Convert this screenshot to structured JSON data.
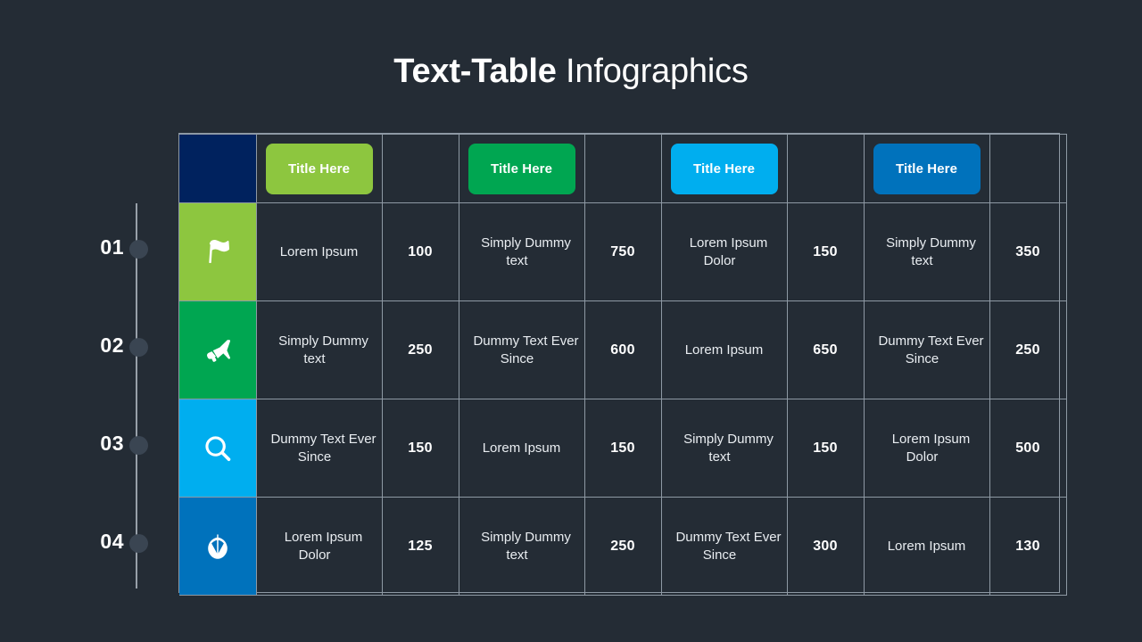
{
  "title": {
    "bold_part": "Text-Table",
    "light_part": " Infographics"
  },
  "timeline": {
    "nodes": [
      {
        "number": "01"
      },
      {
        "number": "02"
      },
      {
        "number": "03"
      },
      {
        "number": "04"
      }
    ]
  },
  "table": {
    "header": {
      "corner_color": "#00225e",
      "cells": [
        {
          "label": "Title Here",
          "color": "#8dc63f"
        },
        {
          "label": "Title Here",
          "color": "#00a651"
        },
        {
          "label": "Title Here",
          "color": "#00aeef"
        },
        {
          "label": "Title Here",
          "color": "#0072bc"
        }
      ]
    },
    "rows": [
      {
        "icon": "flag-icon",
        "icon_bg": "#8dc63f",
        "cells": [
          "Lorem Ipsum",
          "100",
          "Simply Dummy text",
          "750",
          "Lorem Ipsum Dolor",
          "150",
          "Simply Dummy text",
          "350"
        ]
      },
      {
        "icon": "megaphone-icon",
        "icon_bg": "#00a651",
        "cells": [
          "Simply Dummy text",
          "250",
          "Dummy Text Ever Since",
          "600",
          "Lorem Ipsum",
          "650",
          "Dummy Text Ever Since",
          "250"
        ]
      },
      {
        "icon": "search-icon",
        "icon_bg": "#00aeef",
        "cells": [
          "Dummy Text Ever Since",
          "150",
          "Lorem Ipsum",
          "150",
          "Simply Dummy text",
          "150",
          "Lorem Ipsum Dolor",
          "500"
        ]
      },
      {
        "icon": "leaf-icon",
        "icon_bg": "#0072bc",
        "cells": [
          "Lorem Ipsum Dolor",
          "125",
          "Simply Dummy text",
          "250",
          "Dummy Text Ever Since",
          "300",
          "Lorem Ipsum",
          "130"
        ]
      }
    ]
  },
  "colors": {
    "background": "#242c35",
    "grid_line": "#8e99a4",
    "timeline_line": "#b9c2ca",
    "timeline_dot": "#3a4552"
  }
}
